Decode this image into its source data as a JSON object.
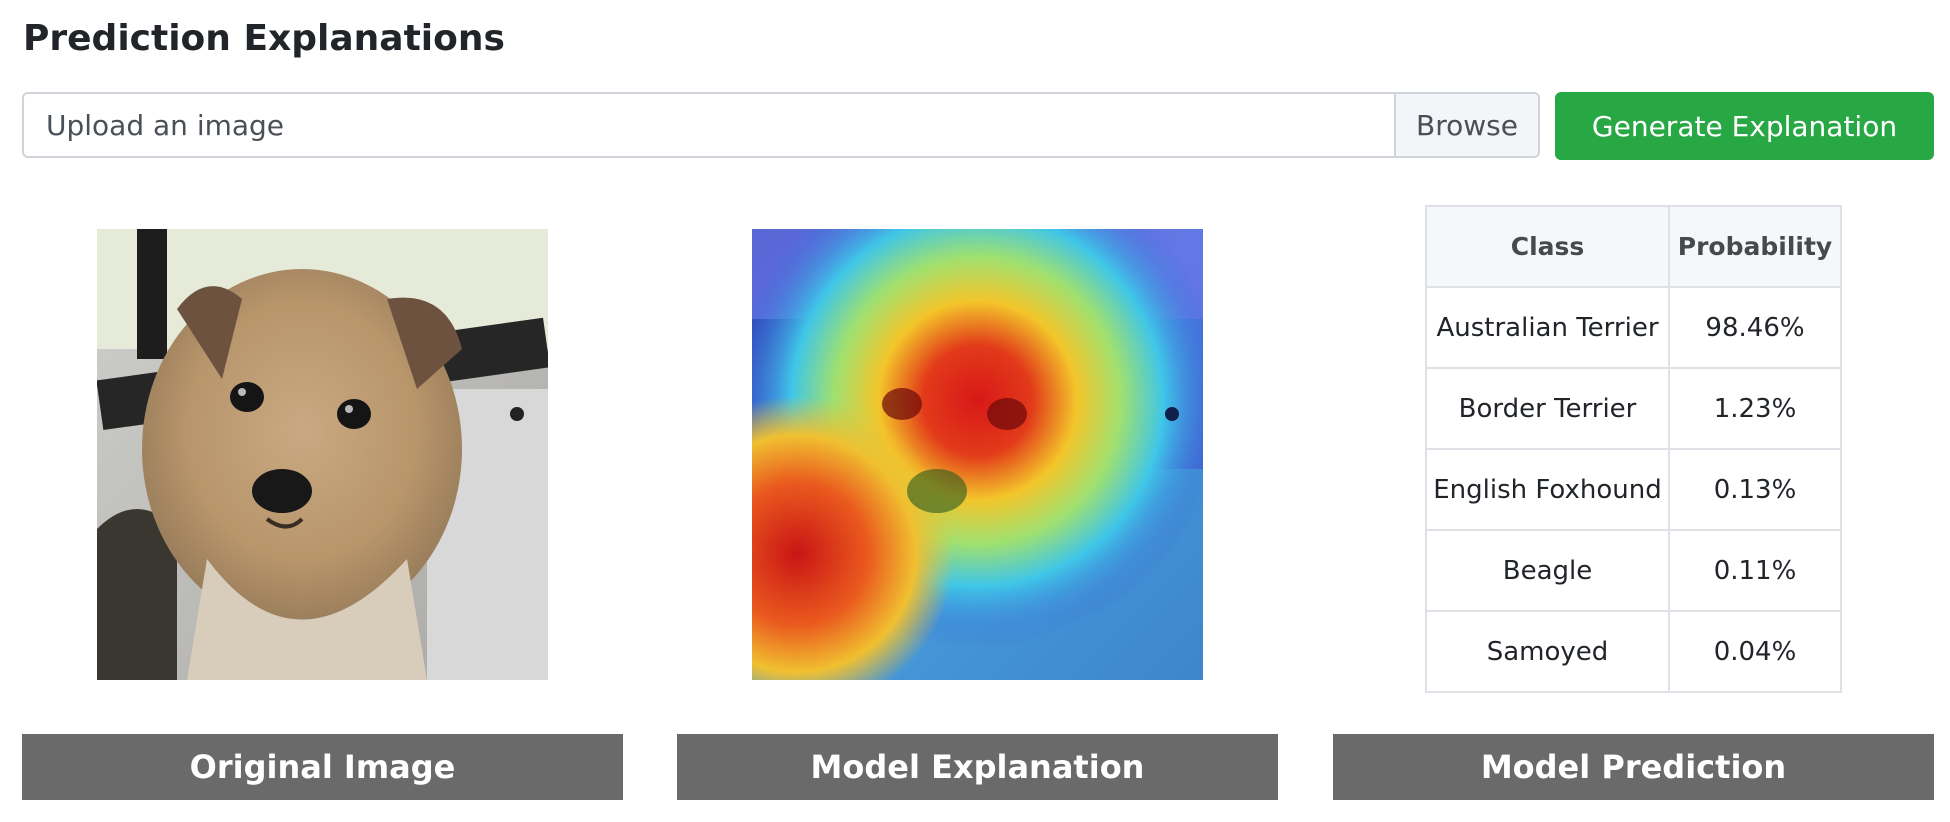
{
  "header": {
    "title": "Prediction Explanations"
  },
  "upload": {
    "placeholder": "Upload an image",
    "browse_label": "Browse",
    "generate_label": "Generate Explanation"
  },
  "panels": {
    "original_caption": "Original Image",
    "explanation_caption": "Model Explanation",
    "prediction_caption": "Model Prediction"
  },
  "prediction_table": {
    "headers": [
      "Class",
      "Probability"
    ],
    "rows": [
      {
        "class": "Australian Terrier",
        "probability": "98.46%"
      },
      {
        "class": "Border Terrier",
        "probability": "1.23%"
      },
      {
        "class": "English Foxhound",
        "probability": "0.13%"
      },
      {
        "class": "Beagle",
        "probability": "0.11%"
      },
      {
        "class": "Samoyed",
        "probability": "0.04%"
      }
    ]
  },
  "colors": {
    "generate_button": "#28a745",
    "caption_bar": "#6a6a6a",
    "table_border": "#dee2e6"
  }
}
